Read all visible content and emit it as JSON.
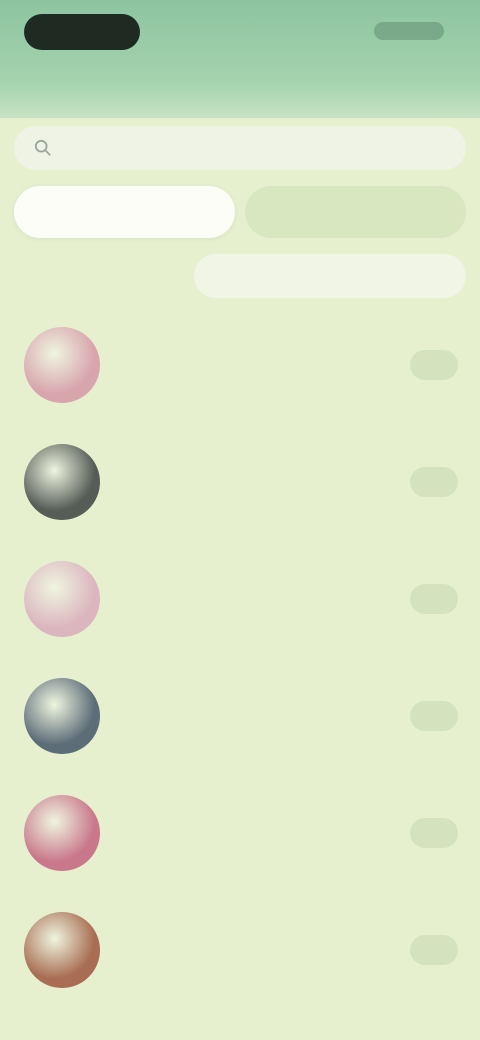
{
  "header": {
    "title": ""
  },
  "search": {
    "placeholder": ""
  },
  "tabs": [
    {
      "label": "",
      "active": true
    },
    {
      "label": "",
      "active": false
    }
  ],
  "section": {
    "label": "",
    "filter_label": ""
  },
  "list": [
    {
      "title": "",
      "subtitle": "",
      "action": "",
      "avatar_color": "#d8a5ad",
      "avatar_icon": "avatar-image"
    },
    {
      "title": "",
      "subtitle": "",
      "action": "",
      "avatar_color": "#565d57",
      "avatar_icon": "avatar-image"
    },
    {
      "title": "",
      "subtitle": "",
      "action": "",
      "avatar_color": "#dcb6bf",
      "avatar_icon": "avatar-image"
    },
    {
      "title": "",
      "subtitle": "",
      "action": "",
      "avatar_color": "#5d6d78",
      "avatar_icon": "avatar-image"
    },
    {
      "title": "",
      "subtitle": "",
      "action": "",
      "avatar_color": "#c9788b",
      "avatar_icon": "avatar-image"
    },
    {
      "title": "",
      "subtitle": "",
      "action": "",
      "avatar_color": "#a86d52",
      "avatar_icon": "avatar-image"
    }
  ],
  "colors": {
    "header": "#8dc4a0",
    "background": "#e6f0cf",
    "active_tab": "#fbfdf6",
    "inactive_tab": "#d8e7c0"
  }
}
